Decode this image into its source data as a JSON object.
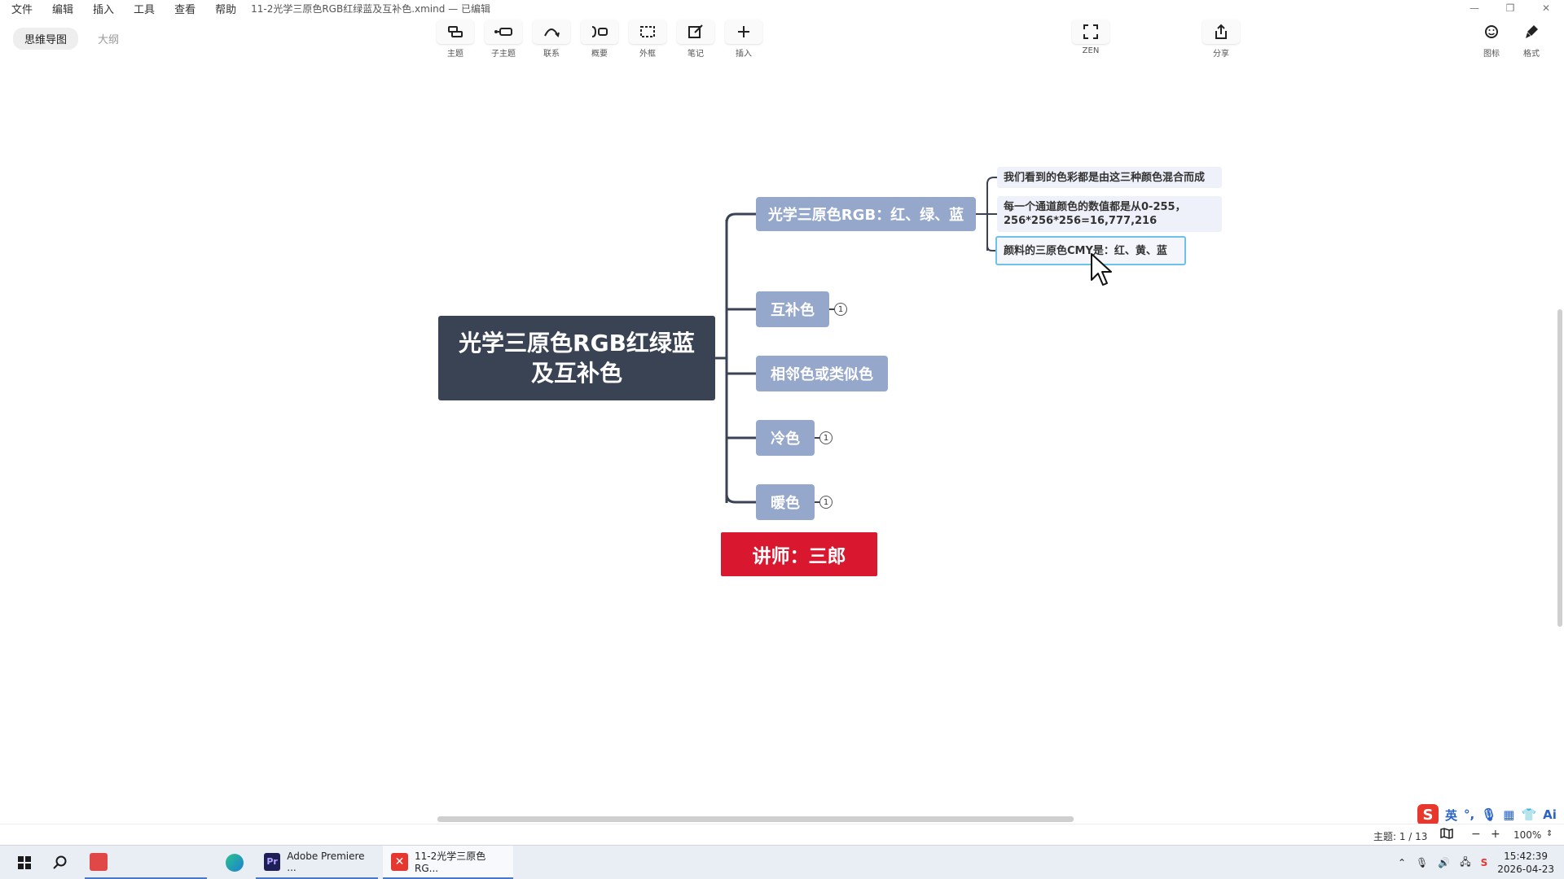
{
  "menubar": {
    "items": [
      "文件",
      "编辑",
      "插入",
      "工具",
      "查看",
      "帮助"
    ],
    "doc_title": "11-2光学三原色RGB红绿蓝及互补色.xmind — 已编辑"
  },
  "toolbar": {
    "view_toggle": {
      "mindmap": "思维导图",
      "outline": "大纲"
    },
    "tools": [
      {
        "label": "主题",
        "icon": "topic-icon"
      },
      {
        "label": "子主题",
        "icon": "subtopic-icon"
      },
      {
        "label": "联系",
        "icon": "relationship-icon"
      },
      {
        "label": "概要",
        "icon": "summary-icon"
      },
      {
        "label": "外框",
        "icon": "boundary-icon"
      },
      {
        "label": "笔记",
        "icon": "note-icon"
      },
      {
        "label": "插入",
        "icon": "plus-icon"
      }
    ],
    "zen": "ZEN",
    "share": "分享",
    "icons_btn": "图标",
    "format_btn": "格式"
  },
  "mindmap": {
    "root": {
      "line1": "光学三原色RGB红绿蓝",
      "line2": "及互补色"
    },
    "branches": [
      {
        "label": "光学三原色RGB：红、绿、蓝",
        "children": [
          "我们看到的色彩都是由这三种颜色混合而成",
          "每一个通道颜色的数值都是从0-255，",
          "256*256*256=16,777,216",
          "颜料的三原色CMY是：红、黄、蓝"
        ]
      },
      {
        "label": "互补色",
        "badge": "1"
      },
      {
        "label": "相邻色或类似色"
      },
      {
        "label": "冷色",
        "badge": "1"
      },
      {
        "label": "暖色",
        "badge": "1"
      }
    ],
    "teacher": "讲师：三郎"
  },
  "statusbar": {
    "topic_count": "主题: 1 / 13",
    "zoom_minus": "−",
    "zoom_plus": "+",
    "zoom": "100%"
  },
  "ime": {
    "logo": "S",
    "lang": "英",
    "ai": "Ai"
  },
  "taskbar": {
    "apps": [
      {
        "label": "Adobe Premiere ..."
      },
      {
        "label": "11-2光学三原色RG..."
      }
    ],
    "time": "15:42:39",
    "date": "2026-04-23"
  },
  "colors": {
    "root_bg": "#3a4354",
    "branch_bg": "#95a7cb",
    "leaf_bg": "#eef1f9",
    "selected_border": "#6ec2ea",
    "teacher_bg": "#d91830"
  }
}
